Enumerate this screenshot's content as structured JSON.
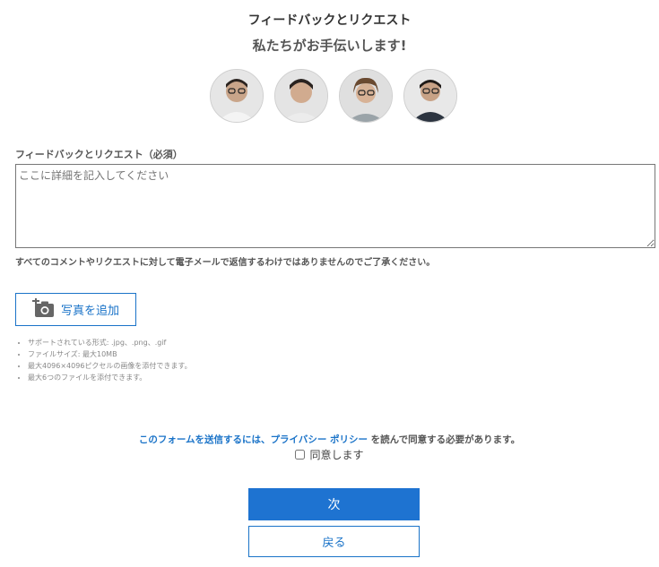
{
  "header": {
    "title": "フィードバックとリクエスト",
    "subtitle": "私たちがお手伝いします!"
  },
  "team": {
    "avatars": [
      "avatar-1",
      "avatar-2",
      "avatar-3",
      "avatar-4"
    ]
  },
  "form": {
    "feedback_label": "フィードバックとリクエスト（必須）",
    "feedback_placeholder": "ここに詳細を記入してください",
    "disclaimer": "すべてのコメントやリクエストに対して電子メールで返信するわけではありませんのでご了承ください。",
    "add_photo_label": "写真を追加",
    "add_photo_icon": "camera-plus-icon",
    "upload_rules": [
      "サポートされている形式: .jpg、.png、.gif",
      "ファイルサイズ: 最大10MB",
      "最大4096×4096ピクセルの画像を添付できます。",
      "最大6つのファイルを添付できます。"
    ],
    "privacy_prefix": "このフォームを送信するには、",
    "privacy_link": "プライバシー ポリシー",
    "privacy_suffix": " を読んで同意する必要があります。",
    "agree_label": "同意します",
    "agree_checked": false
  },
  "actions": {
    "next_label": "次",
    "back_label": "戻る"
  },
  "colors": {
    "accent": "#1e73d1",
    "link": "#1a73c8"
  }
}
